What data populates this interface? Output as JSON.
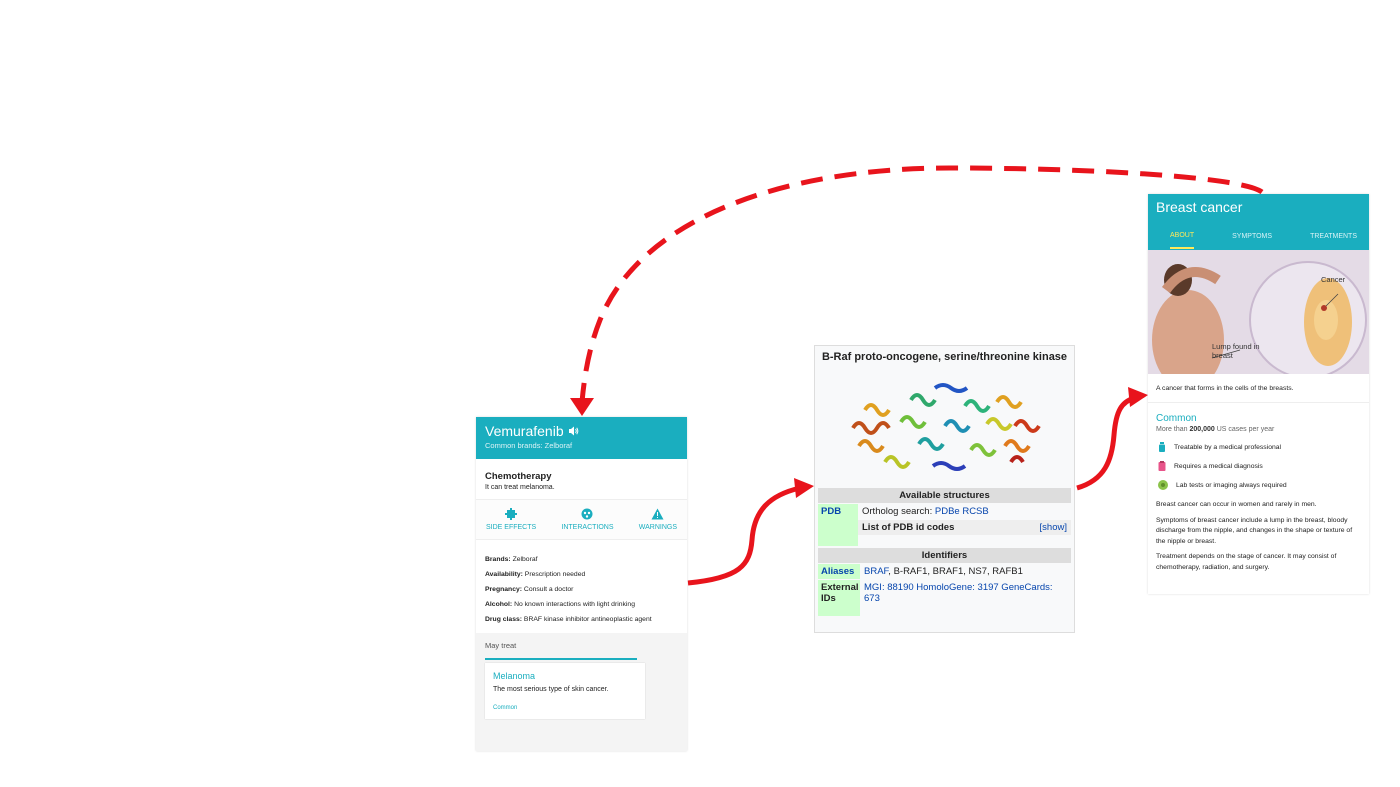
{
  "vemurafenib": {
    "title": "Vemurafenib",
    "speaker_icon": "speaker-icon",
    "subtitle": "Common brands: Zelboraf",
    "class_title": "Chemotherapy",
    "class_desc": "It can treat melanoma.",
    "actions": [
      {
        "label": "SIDE EFFECTS",
        "icon": "side-effects-icon"
      },
      {
        "label": "INTERACTIONS",
        "icon": "interactions-icon"
      },
      {
        "label": "WARNINGS",
        "icon": "warning-icon"
      }
    ],
    "facts": [
      {
        "key": "Brands:",
        "value": "Zelboraf"
      },
      {
        "key": "Availability:",
        "value": "Prescription needed"
      },
      {
        "key": "Pregnancy:",
        "value": "Consult a doctor"
      },
      {
        "key": "Alcohol:",
        "value": "No known interactions with light drinking"
      },
      {
        "key": "Drug class:",
        "value": "BRAF kinase inhibitor antineoplastic agent"
      }
    ],
    "may_treat_label": "May treat",
    "may_treat": {
      "title": "Melanoma",
      "desc": "The most serious type of skin cancer.",
      "tag": "Common"
    },
    "accent_color": "#1aaebf"
  },
  "braf": {
    "title": "B-Raf proto-oncogene, serine/threonine kinase",
    "structures_header": "Available structures",
    "pdb_key": "PDB",
    "ortholog_label": "Ortholog search:",
    "ortholog_links": "PDBe RCSB",
    "pdb_list_label": "List of PDB id codes",
    "show_label": "[show]",
    "identifiers_header": "Identifiers",
    "aliases_key": "Aliases",
    "aliases_link": "BRAF",
    "aliases_rest": ", B-RAF1, BRAF1, NS7, RAFB1",
    "external_key": "External IDs",
    "external_ids": "MGI: 88190 HomoloGene: 3197 GeneCards: 673"
  },
  "breast_cancer": {
    "title": "Breast cancer",
    "tabs": [
      "ABOUT",
      "SYMPTOMS",
      "TREATMENTS"
    ],
    "image_labels": {
      "cancer": "Cancer",
      "lump": "Lump found in breast"
    },
    "definition": "A cancer that forms in the cells of the breasts.",
    "common_title": "Common",
    "common_prefix": "More than ",
    "common_count": "200,000",
    "common_suffix": " US cases per year",
    "features": [
      {
        "text": "Treatable by a medical professional",
        "icon": "medicine-bottle-icon",
        "color": "#1aaebf"
      },
      {
        "text": "Requires a medical diagnosis",
        "icon": "clipboard-icon",
        "color": "#e8548a"
      },
      {
        "text": "Lab tests or imaging always required",
        "icon": "lab-test-icon",
        "color": "#8bc34a"
      }
    ],
    "paragraphs": [
      "Breast cancer can occur in women and rarely in men.",
      "Symptoms of breast cancer include a lump in the breast, bloody discharge from the nipple, and changes in the shape or texture of the nipple or breast.",
      "Treatment depends on the stage of cancer. It may consist of chemotherapy, radiation, and surgery."
    ]
  },
  "arrow_color": "#e8141c"
}
